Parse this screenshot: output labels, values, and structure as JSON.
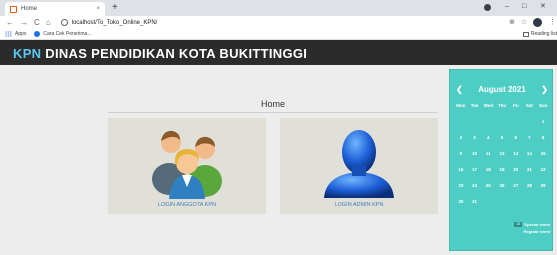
{
  "browser": {
    "tab_title": "Home",
    "tab_close": "×",
    "new_tab": "+",
    "url": "localhost/To_Toko_Online_KPN/",
    "back": "←",
    "forward": "→",
    "reload": "C",
    "home": "⌂",
    "win_min": "–",
    "win_max": "□",
    "win_close": "✕",
    "zoom": "⊕",
    "star": "☆",
    "menu": "⋮",
    "bookmarks": {
      "apps_label": "Apps",
      "item1_label": "Cara Cek Penerima...",
      "reading_list": "Reading list"
    }
  },
  "site": {
    "brand_prefix": "KPN",
    "brand_rest": " DINAS PENDIDIKAN KOTA BUKITTINGGI"
  },
  "main": {
    "home_title": "Home",
    "cards": [
      {
        "label": "LOGIN ANGGOTA KPN",
        "image": "group-of-people-icon"
      },
      {
        "label": "LOGIN ADMIN KPN",
        "image": "admin-user-silhouette-icon"
      }
    ]
  },
  "calendar": {
    "month_label": "August 2021",
    "prev": "❮",
    "next": "❯",
    "weekdays": [
      "Mon",
      "Tue",
      "Wed",
      "Thu",
      "Fri",
      "Sat",
      "Sun"
    ],
    "cells": [
      "",
      "",
      "",
      "",
      "",
      "",
      "1",
      "2",
      "3",
      "4",
      "5",
      "6",
      "7",
      "8",
      "9",
      "10",
      "11",
      "12",
      "13",
      "14",
      "15",
      "16",
      "17",
      "18",
      "19",
      "20",
      "21",
      "22",
      "23",
      "24",
      "25",
      "26",
      "27",
      "28",
      "29",
      "30",
      "31",
      "",
      "",
      "",
      "",
      ""
    ],
    "legend": {
      "swatch_text": "15",
      "special_event": "Special event",
      "regular_event": "Regular event"
    },
    "colors": {
      "background": "#4ecdc4",
      "text": "#ffffff"
    }
  },
  "colors": {
    "header_bg": "#2b2b2b",
    "brand_accent": "#5bc8f3",
    "link": "#3d7fb8"
  }
}
